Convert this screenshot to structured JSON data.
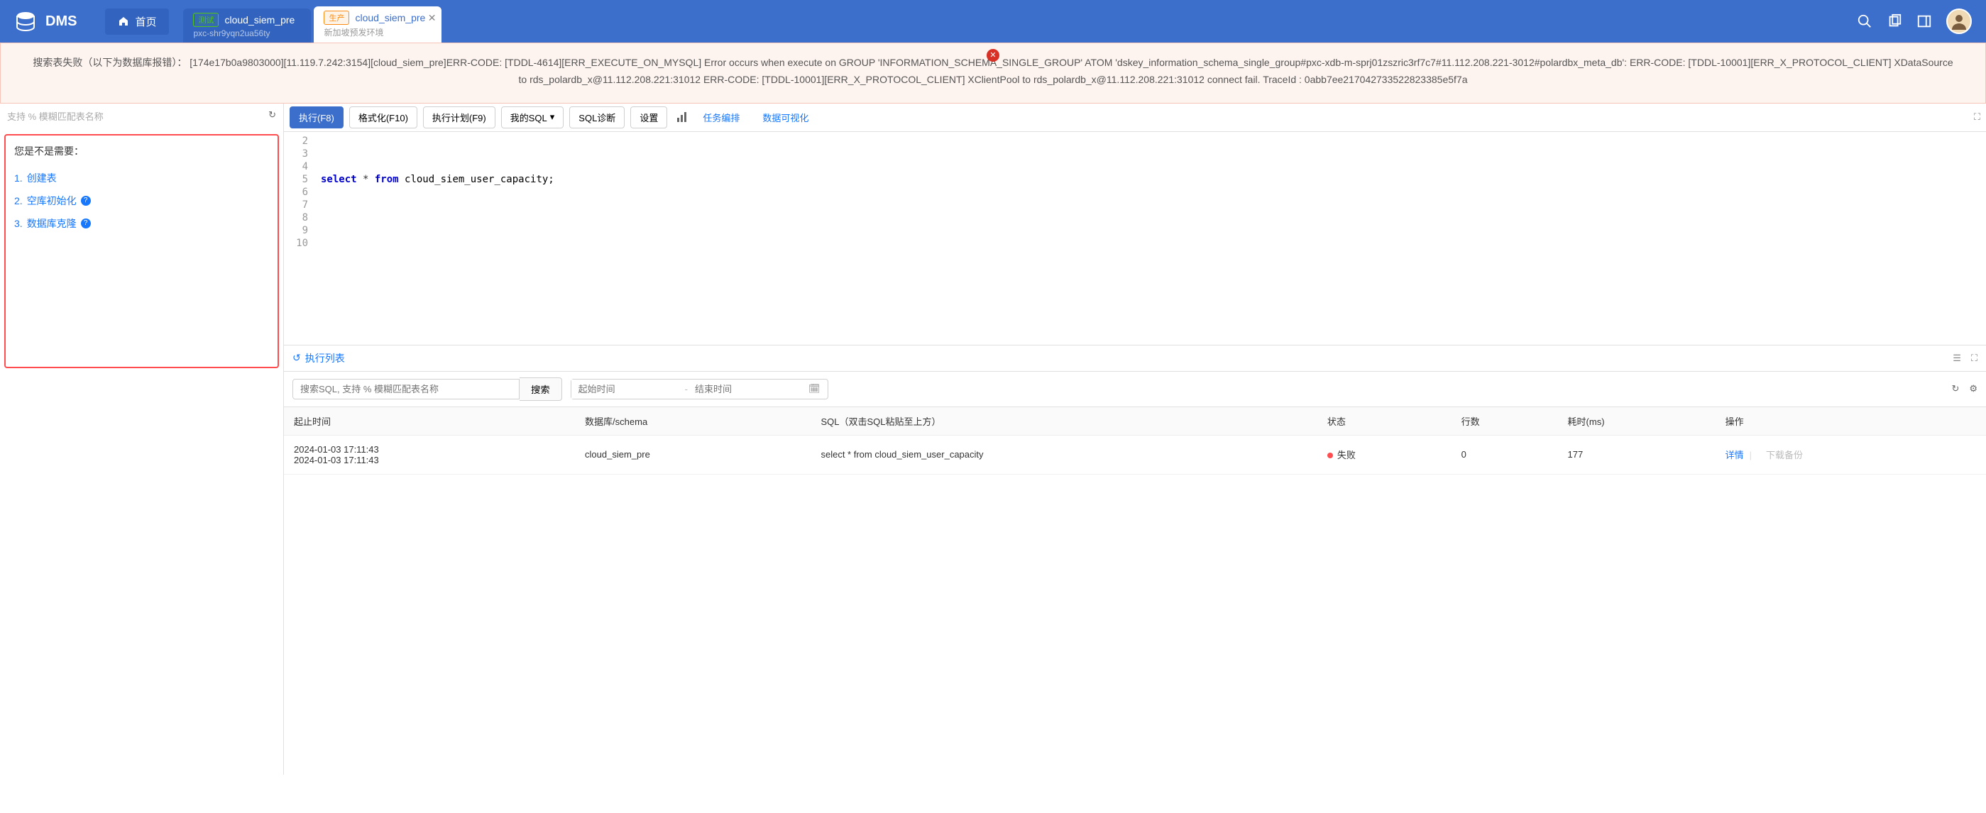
{
  "header": {
    "app_name": "DMS",
    "home_label": "首页"
  },
  "tabs": [
    {
      "badge": "测试",
      "badge_type": "test",
      "name": "cloud_siem_pre",
      "sub": "pxc-shr9yqn2ua56ty",
      "active": false
    },
    {
      "badge": "生产",
      "badge_type": "prod",
      "name": "cloud_siem_pre",
      "sub": "新加坡预发环境",
      "active": true
    }
  ],
  "error": {
    "message": "搜索表失败（以下为数据库报错）：  [174e17b0a9803000][11.119.7.242:3154][cloud_siem_pre]ERR-CODE: [TDDL-4614][ERR_EXECUTE_ON_MYSQL] Error occurs when execute on GROUP 'INFORMATION_SCHEMA_SINGLE_GROUP' ATOM 'dskey_information_schema_single_group#pxc-xdb-m-sprj01zszric3rf7c7#11.112.208.221-3012#polardbx_meta_db': ERR-CODE: [TDDL-10001][ERR_X_PROTOCOL_CLIENT] XDataSource to rds_polardb_x@11.112.208.221:31012 ERR-CODE: [TDDL-10001][ERR_X_PROTOCOL_CLIENT] XClientPool to rds_polardb_x@11.112.208.221:31012 connect fail. TraceId : 0abb7ee217042733522823385e5f7a"
  },
  "sidebar": {
    "search_hint": "支持 % 模糊匹配表名称",
    "suggest_title": "您是不是需要：",
    "suggestions": [
      {
        "idx": "1.",
        "label": "创建表",
        "help": false
      },
      {
        "idx": "2.",
        "label": "空库初始化",
        "help": true
      },
      {
        "idx": "3.",
        "label": "数据库克隆",
        "help": true
      }
    ]
  },
  "toolbar": {
    "run": "执行(F8)",
    "format": "格式化(F10)",
    "plan": "执行计划(F9)",
    "mysql": "我的SQL",
    "diag": "SQL诊断",
    "settings": "设置",
    "task_arrange": "任务编排",
    "data_viz": "数据可视化"
  },
  "editor": {
    "line_start": 2,
    "line_end": 10,
    "code_line": 5,
    "code_kw1": "select",
    "code_star": " * ",
    "code_kw2": "from",
    "code_rest": " cloud_siem_user_capacity;"
  },
  "exec": {
    "title": "执行列表",
    "filter_sql_placeholder": "搜索SQL, 支持 % 模糊匹配表名称",
    "search_btn": "搜索",
    "start_placeholder": "起始时间",
    "end_placeholder": "结束时间",
    "columns": {
      "time": "起止时间",
      "schema": "数据库/schema",
      "sql": "SQL（双击SQL粘贴至上方）",
      "status": "状态",
      "rows": "行数",
      "elapsed": "耗时(ms)",
      "action": "操作"
    },
    "row": {
      "time1": "2024-01-03 17:11:43",
      "time2": "2024-01-03 17:11:43",
      "schema": "cloud_siem_pre",
      "sql": "select * from cloud_siem_user_capacity",
      "status": "失败",
      "rows": "0",
      "elapsed": "177",
      "detail": "详情",
      "download": "下载备份"
    }
  }
}
